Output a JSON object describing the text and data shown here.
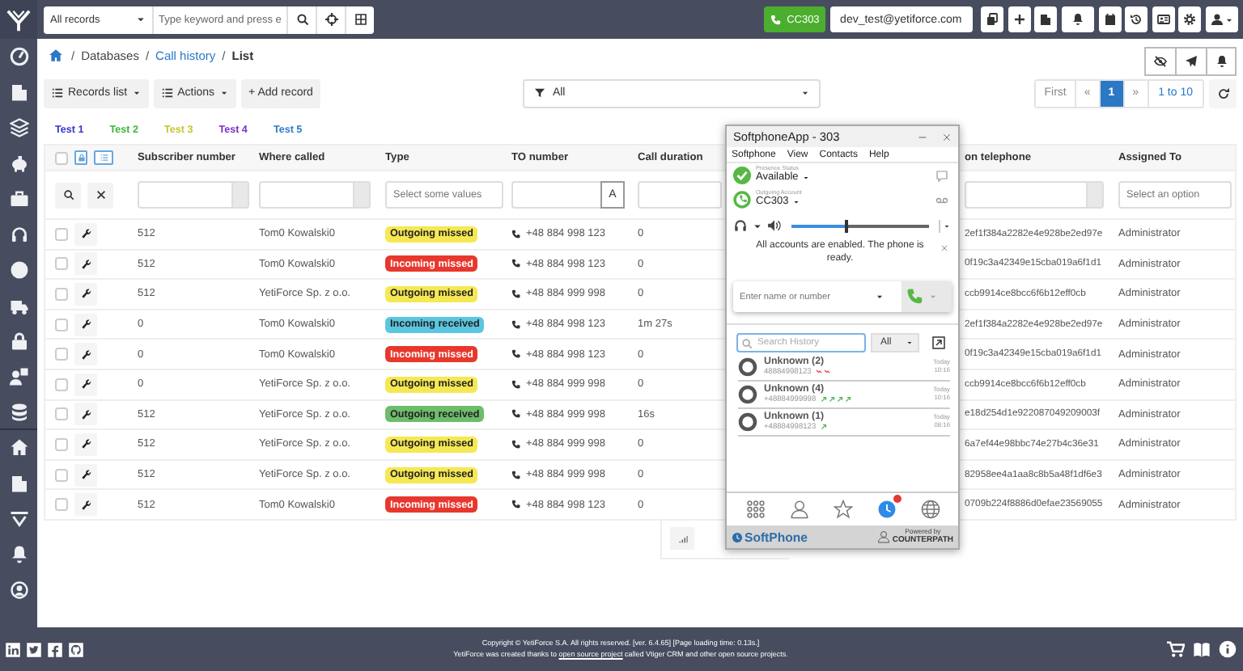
{
  "topbar": {
    "search_scope": "All records",
    "search_placeholder": "Type keyword and press e",
    "call_button": "CC303",
    "user_email": "dev_test@yetiforce.com"
  },
  "breadcrumb": [
    {
      "kind": "separator",
      "label": "/"
    },
    {
      "kind": "text",
      "label": "Databases"
    },
    {
      "kind": "separator",
      "label": "/"
    },
    {
      "kind": "link",
      "label": "Call history"
    },
    {
      "kind": "separator",
      "label": "/"
    },
    {
      "kind": "current",
      "label": "List"
    }
  ],
  "toolbar": {
    "records_list": "Records list",
    "actions": "Actions",
    "add_record": "+ Add record",
    "filter": "All"
  },
  "pagination": {
    "first": "First",
    "prev": "«",
    "pages": [
      {
        "label": "1",
        "selected": true
      }
    ],
    "next": "»",
    "range": "1 to 10"
  },
  "tags": [
    {
      "label": "Test 1",
      "color": "#3434c8"
    },
    {
      "label": "Test 2",
      "color": "#3fb53f"
    },
    {
      "label": "Test 3",
      "color": "#c5c52e"
    },
    {
      "label": "Test 4",
      "color": "#7a2fc4"
    },
    {
      "label": "Test 5",
      "color": "#2f7bc4"
    }
  ],
  "table": {
    "all_selected": false,
    "columns": [
      "Subscriber number",
      "Where called",
      "Type",
      "TO number",
      "Call duration",
      "on telephone",
      "Assigned To"
    ],
    "filters": [
      {
        "kind": "text"
      },
      {
        "kind": "text"
      },
      {
        "kind": "select",
        "placeholder": "Select some values"
      },
      {
        "kind": "letter",
        "button": "A"
      },
      {
        "kind": "plain"
      },
      {
        "kind": "text"
      },
      {
        "kind": "select",
        "placeholder": "Select an option"
      }
    ],
    "rows": [
      {
        "selected": false,
        "subscriber": "512",
        "where_called": "Tom0 Kowalski0",
        "type": {
          "label": "Outgoing missed",
          "color": "#f5e853"
        },
        "to_number": "+48 884 998 123",
        "duration": "0",
        "telephone": "2ef1f384a2282e4e928be2ed97e",
        "assigned_to": "Administrator"
      },
      {
        "selected": false,
        "subscriber": "512",
        "where_called": "Tom0 Kowalski0",
        "type": {
          "label": "Incoming missed",
          "color": "#e8372c"
        },
        "to_number": "+48 884 998 123",
        "duration": "0",
        "telephone": "0f19c3a42349e15cba019a6f1d1",
        "assigned_to": "Administrator"
      },
      {
        "selected": false,
        "subscriber": "512",
        "where_called": "YetiForce Sp. z o.o.",
        "type": {
          "label": "Outgoing missed",
          "color": "#f5e853"
        },
        "to_number": "+48 884 999 998",
        "duration": "0",
        "telephone": "ccb9914ce8bcc6f6b12eff0cb",
        "assigned_to": "Administrator"
      },
      {
        "selected": false,
        "subscriber": "0",
        "where_called": "Tom0 Kowalski0",
        "type": {
          "label": "Incoming received",
          "color": "#5bc6df"
        },
        "to_number": "+48 884 998 123",
        "duration": "1m 27s",
        "telephone": "2ef1f384a2282e4e928be2ed97e",
        "assigned_to": "Administrator"
      },
      {
        "selected": false,
        "subscriber": "0",
        "where_called": "Tom0 Kowalski0",
        "type": {
          "label": "Incoming missed",
          "color": "#e8372c"
        },
        "to_number": "+48 884 998 123",
        "duration": "0",
        "telephone": "0f19c3a42349e15cba019a6f1d1",
        "assigned_to": "Administrator"
      },
      {
        "selected": false,
        "subscriber": "0",
        "where_called": "YetiForce Sp. z o.o.",
        "type": {
          "label": "Outgoing missed",
          "color": "#f5e853"
        },
        "to_number": "+48 884 999 998",
        "duration": "0",
        "telephone": "ccb9914ce8bcc6f6b12eff0cb",
        "assigned_to": "Administrator"
      },
      {
        "selected": false,
        "subscriber": "512",
        "where_called": "YetiForce Sp. z o.o.",
        "type": {
          "label": "Outgoing received",
          "color": "#6dbd6b"
        },
        "to_number": "+48 884 999 998",
        "duration": "16s",
        "telephone": "e18d254d1e922087049209003f",
        "assigned_to": "Administrator"
      },
      {
        "selected": false,
        "subscriber": "512",
        "where_called": "YetiForce Sp. z o.o.",
        "type": {
          "label": "Outgoing missed",
          "color": "#f5e853"
        },
        "to_number": "+48 884 999 998",
        "duration": "0",
        "telephone": "6a7ef44e98bbc74e27b4c36e31",
        "assigned_to": "Administrator"
      },
      {
        "selected": false,
        "subscriber": "512",
        "where_called": "YetiForce Sp. z o.o.",
        "type": {
          "label": "Outgoing missed",
          "color": "#f5e853"
        },
        "to_number": "+48 884 999 998",
        "duration": "0",
        "telephone": "82958ee4a1aa8c8b5a48f1df6e3",
        "assigned_to": "Administrator"
      },
      {
        "selected": false,
        "subscriber": "512",
        "where_called": "Tom0 Kowalski0",
        "type": {
          "label": "Incoming missed",
          "color": "#e8372c"
        },
        "to_number": "+48 884 998 123",
        "duration": "0",
        "telephone": "0709b224f8886d0efae23569055",
        "assigned_to": "Administrator"
      }
    ]
  },
  "softphone": {
    "title": "SoftphoneApp - 303",
    "menu": [
      "Softphone",
      "View",
      "Contacts",
      "Help"
    ],
    "presence": {
      "label": "Presence Status",
      "value": "Available"
    },
    "account": {
      "label": "Outgoing Account",
      "value": "CC303"
    },
    "volume": {
      "level": 0.4
    },
    "message": "All accounts are enabled. The phone is ready.",
    "dial_placeholder": "Enter name or number",
    "search_placeholder": "Search History",
    "history_filter": "All",
    "history": [
      {
        "name": "Unknown (2)",
        "number": "48884998123",
        "date": "Today",
        "time": "10:16",
        "calls": [
          {
            "kind": "missed"
          },
          {
            "kind": "missed"
          }
        ]
      },
      {
        "name": "Unknown (4)",
        "number": "+48884999998",
        "date": "Today",
        "time": "10:16",
        "calls": [
          {
            "kind": "outgoing"
          },
          {
            "kind": "outgoing"
          },
          {
            "kind": "outgoing"
          },
          {
            "kind": "outgoing"
          }
        ]
      },
      {
        "name": "Unknown (1)",
        "number": "+48884998123",
        "date": "Today",
        "time": "08:16",
        "calls": [
          {
            "kind": "outgoing"
          }
        ]
      }
    ],
    "tabs": [
      {
        "kind": "dialpad",
        "selected": false,
        "badge": false
      },
      {
        "kind": "contacts",
        "selected": false,
        "badge": false
      },
      {
        "kind": "favorites",
        "selected": false,
        "badge": false
      },
      {
        "kind": "history",
        "selected": true,
        "badge": true
      },
      {
        "kind": "web",
        "selected": false,
        "badge": false
      }
    ],
    "brand": "SoftPhone",
    "powered_by": "Powered by",
    "vendor": "COUNTERPATH"
  },
  "footer": {
    "copyright": "Copyright © YetiForce S.A. All rights reserved. [ver. 6.4.65] [Page loading time: 0.13s.]",
    "credit_before": "YetiForce was created thanks to",
    "credit_link": "open source project",
    "credit_after": "called Vtiger CRM and other open source projects."
  }
}
